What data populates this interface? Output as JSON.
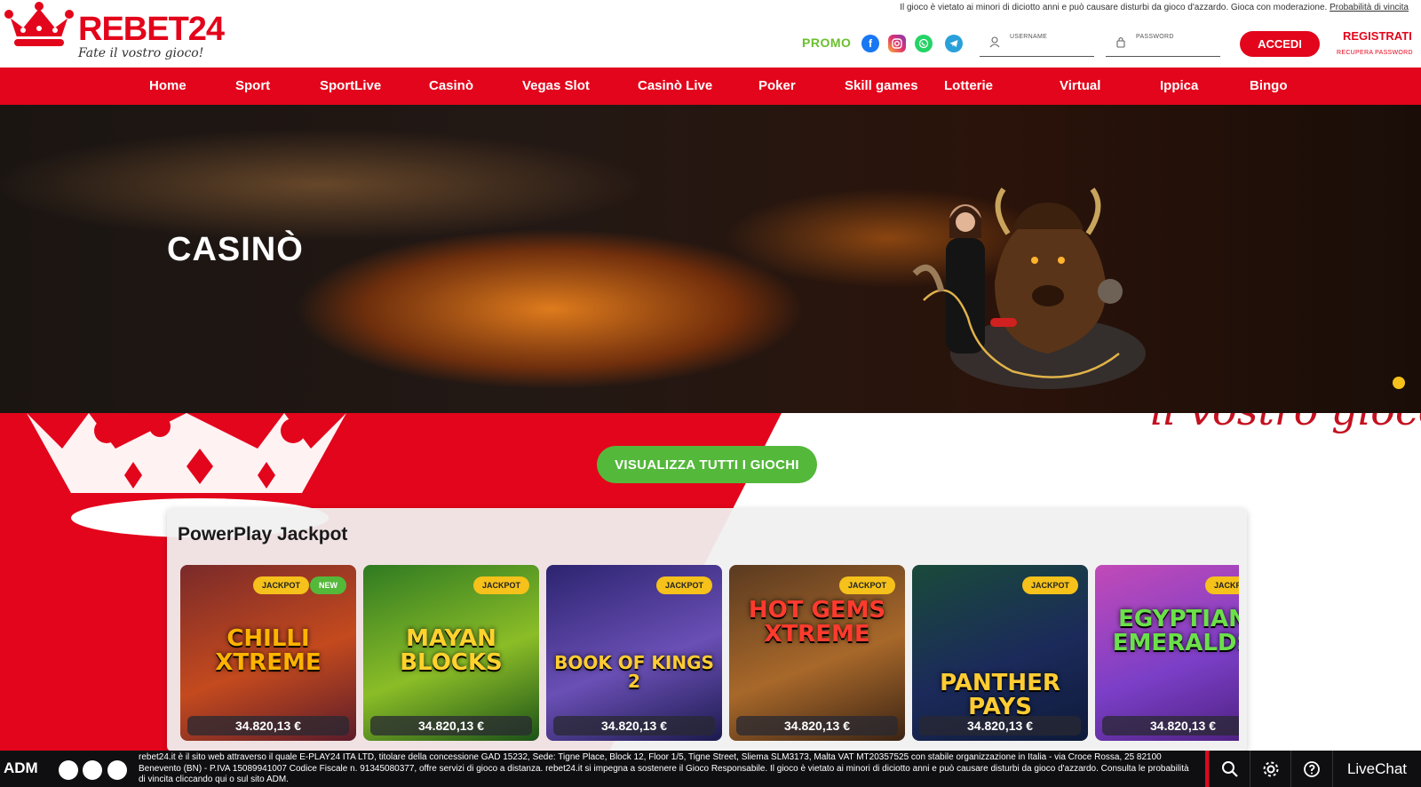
{
  "brand": {
    "name_red": "REBET",
    "name_num": "24",
    "tagline": "Fate il vostro gioco!"
  },
  "header": {
    "disclaimer": "Il gioco è vietato ai minori di diciotto anni e può causare disturbi da gioco d'azzardo. Gioca con moderazione.",
    "disclaimer_link": "Probabilità di vincita",
    "promo_label": "PROMO",
    "username_label": "USERNAME",
    "password_label": "PASSWORD",
    "login_label": "ACCEDI",
    "register_label": "REGISTRATI",
    "recover_label": "RECUPERA PASSWORD",
    "social_icons": [
      "facebook-icon",
      "instagram-icon",
      "whatsapp-icon",
      "telegram-icon"
    ]
  },
  "nav": {
    "items": [
      "Home",
      "Sport",
      "SportLive",
      "Casinò",
      "Vegas Slot",
      "Casinò Live",
      "Poker",
      "Skill games",
      "Lotterie",
      "Virtual",
      "Ippica",
      "Bingo"
    ]
  },
  "hero": {
    "title": "CASINÒ"
  },
  "background_tagline": "il vostro gioco!",
  "cta": {
    "view_all_label": "VISUALIZZA TUTTI I GIOCHI"
  },
  "jackpot_section": {
    "title": "PowerPlay Jackpot",
    "games": [
      {
        "name": "CHILLI XTREME",
        "badges": [
          "JACKPOT",
          "NEW"
        ],
        "amount": "34.820,13 €"
      },
      {
        "name": "MAYAN BLOCKS",
        "badges": [
          "JACKPOT"
        ],
        "amount": "34.820,13 €"
      },
      {
        "name": "BOOK OF KINGS 2",
        "badges": [
          "JACKPOT"
        ],
        "amount": "34.820,13 €"
      },
      {
        "name": "HOT GEMS XTREME",
        "badges": [
          "JACKPOT"
        ],
        "amount": "34.820,13 €"
      },
      {
        "name": "PANTHER PAYS",
        "badges": [
          "JACKPOT"
        ],
        "amount": "34.820,13 €"
      },
      {
        "name": "EGYPTIAN EMERALDS",
        "badges": [
          "JACKP"
        ],
        "amount": "34.820,13 €"
      }
    ]
  },
  "footer": {
    "adm_label": "ADM",
    "legal_text": "rebet24.it è il sito web attraverso il quale E-PLAY24 ITA LTD, titolare della concessione GAD 15232, Sede: Tigne Place, Block 12, Floor 1/5, Tigne Street, Sliema SLM3173, Malta VAT MT20357525 con stabile organizzazione in Italia - via Croce Rossa, 25 82100 Benevento (BN) - P.IVA 15089941007 Codice Fiscale n. 91345080377, offre servizi di gioco a distanza. rebet24.it si impegna a sostenere il Gioco Responsabile. Il gioco è vietato ai minori di diciotto anni e può causare disturbi da gioco d'azzardo. Consulta le probabilità di vincita cliccando qui o sul sito ADM.",
    "live_chat_label": "LiveChat"
  },
  "colors": {
    "brand_red": "#e3051b",
    "promo_green": "#6abf2e",
    "cta_green": "#54b83a",
    "jackpot_yellow": "#f5c11a"
  }
}
